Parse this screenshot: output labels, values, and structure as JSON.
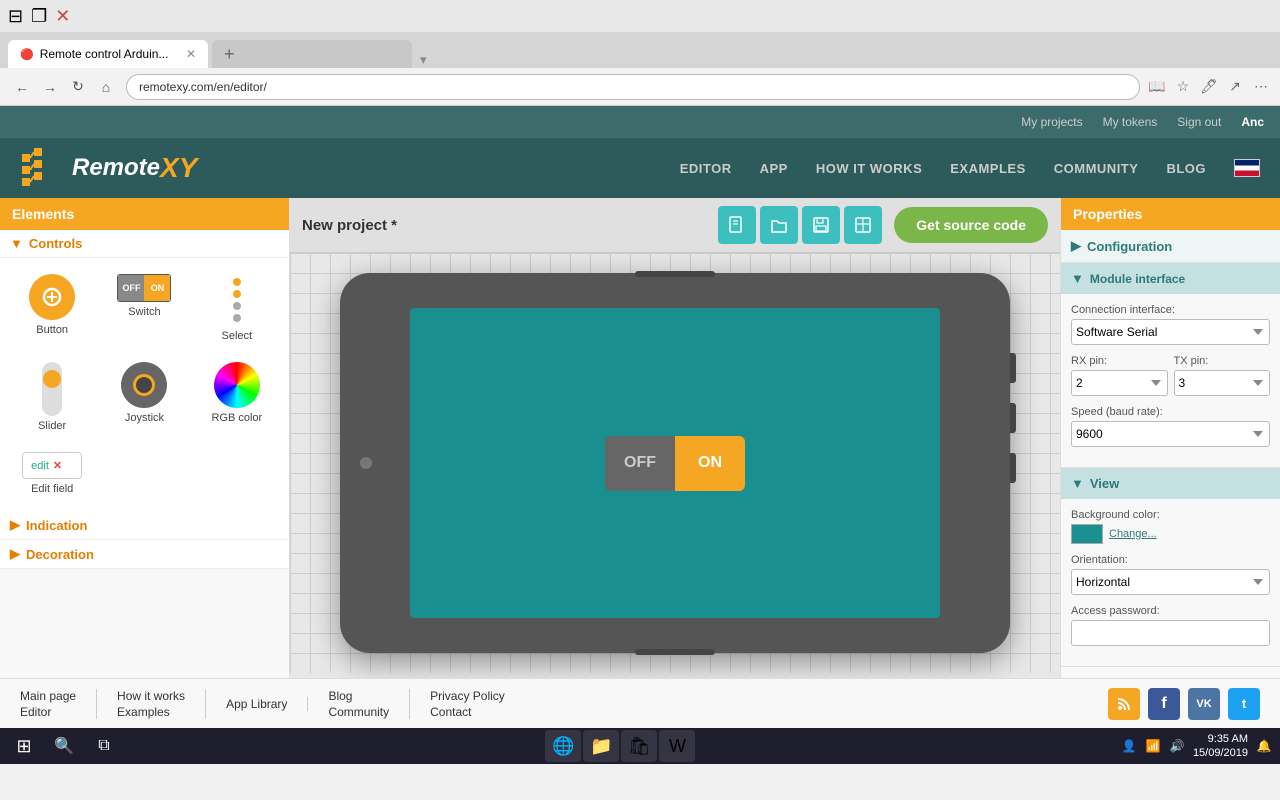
{
  "browser": {
    "tab_title": "Remote control Arduin...",
    "tab_icon": "🔴",
    "address": "remotexy.com/en/editor/",
    "nav": {
      "back": "←",
      "forward": "→",
      "refresh": "↻",
      "home": "⌂"
    }
  },
  "topbar": {
    "my_projects": "My projects",
    "my_tokens": "My tokens",
    "sign_out": "Sign out",
    "user": "Anc"
  },
  "navbar": {
    "logo_text": "Remote",
    "logo_xy": "XY",
    "links": [
      "EDITOR",
      "APP",
      "HOW IT WORKS",
      "EXAMPLES",
      "COMMUNITY",
      "BLOG"
    ]
  },
  "elements_panel": {
    "header": "Elements",
    "controls_section": "Controls",
    "controls": [
      {
        "label": "Button",
        "icon": "button"
      },
      {
        "label": "Switch",
        "icon": "switch"
      },
      {
        "label": "Select",
        "icon": "select"
      },
      {
        "label": "Slider",
        "icon": "slider"
      },
      {
        "label": "Joystick",
        "icon": "joystick"
      },
      {
        "label": "RGB color",
        "icon": "rgb"
      },
      {
        "label": "Edit field",
        "icon": "editfield"
      }
    ],
    "indication_section": "Indication",
    "decoration_section": "Decoration"
  },
  "canvas": {
    "project_title": "New project *",
    "get_source_btn": "Get source code",
    "toolbar_icons": [
      "📄",
      "🗂️",
      "💾",
      "📐"
    ]
  },
  "properties": {
    "header": "Properties",
    "configuration_section": "Configuration",
    "module_interface_section": "Module interface",
    "connection_label": "Connection interface:",
    "connection_value": "Software Serial",
    "rx_pin_label": "RX pin:",
    "rx_pin_value": "2",
    "tx_pin_label": "TX pin:",
    "tx_pin_value": "3",
    "speed_label": "Speed (baud rate):",
    "speed_value": "9600",
    "view_section": "View",
    "bg_color_label": "Background color:",
    "bg_color_value": "#1a8f8f",
    "change_btn": "Change...",
    "orientation_label": "Orientation:",
    "orientation_value": "Horizontal",
    "access_password_label": "Access password:",
    "access_password_value": ""
  },
  "footer": {
    "cols": [
      {
        "links": [
          "Main page",
          "Editor"
        ]
      },
      {
        "links": [
          "How it works",
          "Examples"
        ]
      },
      {
        "links": [
          "App Library"
        ]
      },
      {
        "links": [
          "Blog",
          "Community"
        ]
      },
      {
        "links": [
          "Privacy Policy",
          "Contact"
        ]
      }
    ]
  },
  "taskbar": {
    "time": "9:35 AM",
    "date": "15/09/2019",
    "start_icon": "⊞",
    "search_icon": "🔍",
    "task_icon": "⧉"
  },
  "phone": {
    "switch_off_label": "OFF",
    "switch_on_label": "ON"
  }
}
